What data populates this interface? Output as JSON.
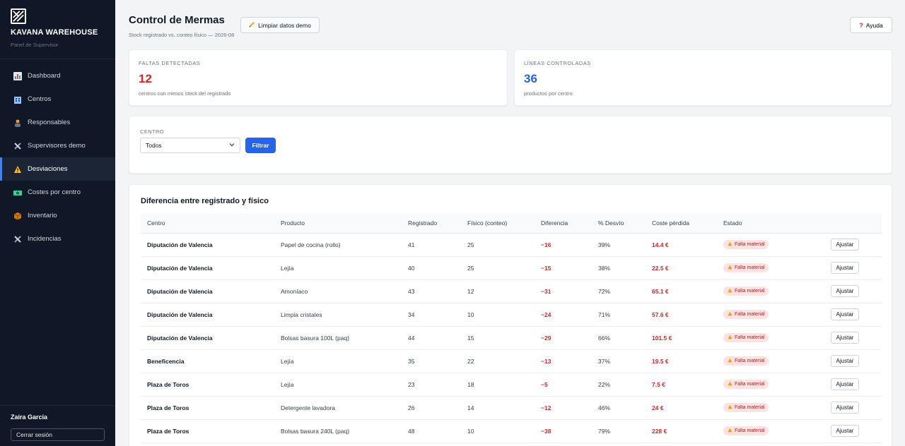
{
  "sidebar": {
    "brand": "KAVANA WAREHOUSE",
    "subtitle": "Panel de Supervisor",
    "items": [
      {
        "label": "Dashboard",
        "icon": "bar-chart-icon",
        "active": false
      },
      {
        "label": "Centros",
        "icon": "building-icon",
        "active": false
      },
      {
        "label": "Responsables",
        "icon": "person-icon",
        "active": false
      },
      {
        "label": "Supervisores demo",
        "icon": "tools-icon",
        "active": false
      },
      {
        "label": "Desviaciones",
        "icon": "warning-icon",
        "active": true
      },
      {
        "label": "Costes por centro",
        "icon": "money-icon",
        "active": false
      },
      {
        "label": "Inventario",
        "icon": "box-icon",
        "active": false
      },
      {
        "label": "Incidencias",
        "icon": "tools-icon",
        "active": false
      }
    ],
    "user_name": "Zaira García",
    "logout_label": "Cerrar sesión"
  },
  "header": {
    "title": "Control de Mermas",
    "subtitle": "Stock registrado vs. conteo físico — 2026-08",
    "clear_label": "Limpiar datos demo",
    "help_label": "Ayuda"
  },
  "stats": {
    "faltas": {
      "label": "FALTAS DETECTADAS",
      "value": "12",
      "desc": "centros con menos stock del registrado"
    },
    "lineas": {
      "label": "LÍNEAS CONTROLADAS",
      "value": "36",
      "desc": "productos por centro"
    }
  },
  "filter": {
    "label": "CENTRO",
    "selected": "Todos",
    "button": "Filtrar"
  },
  "table": {
    "title": "Diferencia entre registrado y físico",
    "headers": [
      "Centro",
      "Producto",
      "Registrado",
      "Físico (conteo)",
      "Diferencia",
      "% Desvío",
      "Coste pérdida",
      "Estado",
      ""
    ],
    "rows": [
      [
        "Diputación de Valencia",
        "Papel de cocina (rollo)",
        "41",
        "25",
        "−16",
        "39%",
        "14.4 €",
        "Falta material",
        "Ajustar"
      ],
      [
        "Diputación de Valencia",
        "Lejía",
        "40",
        "25",
        "−15",
        "38%",
        "22.5 €",
        "Falta material",
        "Ajustar"
      ],
      [
        "Diputación de Valencia",
        "Amoníaco",
        "43",
        "12",
        "−31",
        "72%",
        "65.1 €",
        "Falta material",
        "Ajustar"
      ],
      [
        "Diputación de Valencia",
        "Limpia cristales",
        "34",
        "10",
        "−24",
        "71%",
        "57.6 €",
        "Falta material",
        "Ajustar"
      ],
      [
        "Diputación de Valencia",
        "Bolsas basura 100L (paq)",
        "44",
        "15",
        "−29",
        "66%",
        "101.5 €",
        "Falta material",
        "Ajustar"
      ],
      [
        "Beneficencia",
        "Lejía",
        "35",
        "22",
        "−13",
        "37%",
        "19.5 €",
        "Falta material",
        "Ajustar"
      ],
      [
        "Plaza de Toros",
        "Lejía",
        "23",
        "18",
        "−5",
        "22%",
        "7.5 €",
        "Falta material",
        "Ajustar"
      ],
      [
        "Plaza de Toros",
        "Detergente lavadora",
        "26",
        "14",
        "−12",
        "46%",
        "24 €",
        "Falta material",
        "Ajustar"
      ],
      [
        "Plaza de Toros",
        "Bolsas basura 240L (paq)",
        "48",
        "10",
        "−38",
        "79%",
        "228 €",
        "Falta material",
        "Ajustar"
      ]
    ]
  },
  "colors": {
    "accent": "#2563eb",
    "danger": "#dc2626",
    "sidebar_bg": "#101827",
    "info": "#2563eb"
  }
}
